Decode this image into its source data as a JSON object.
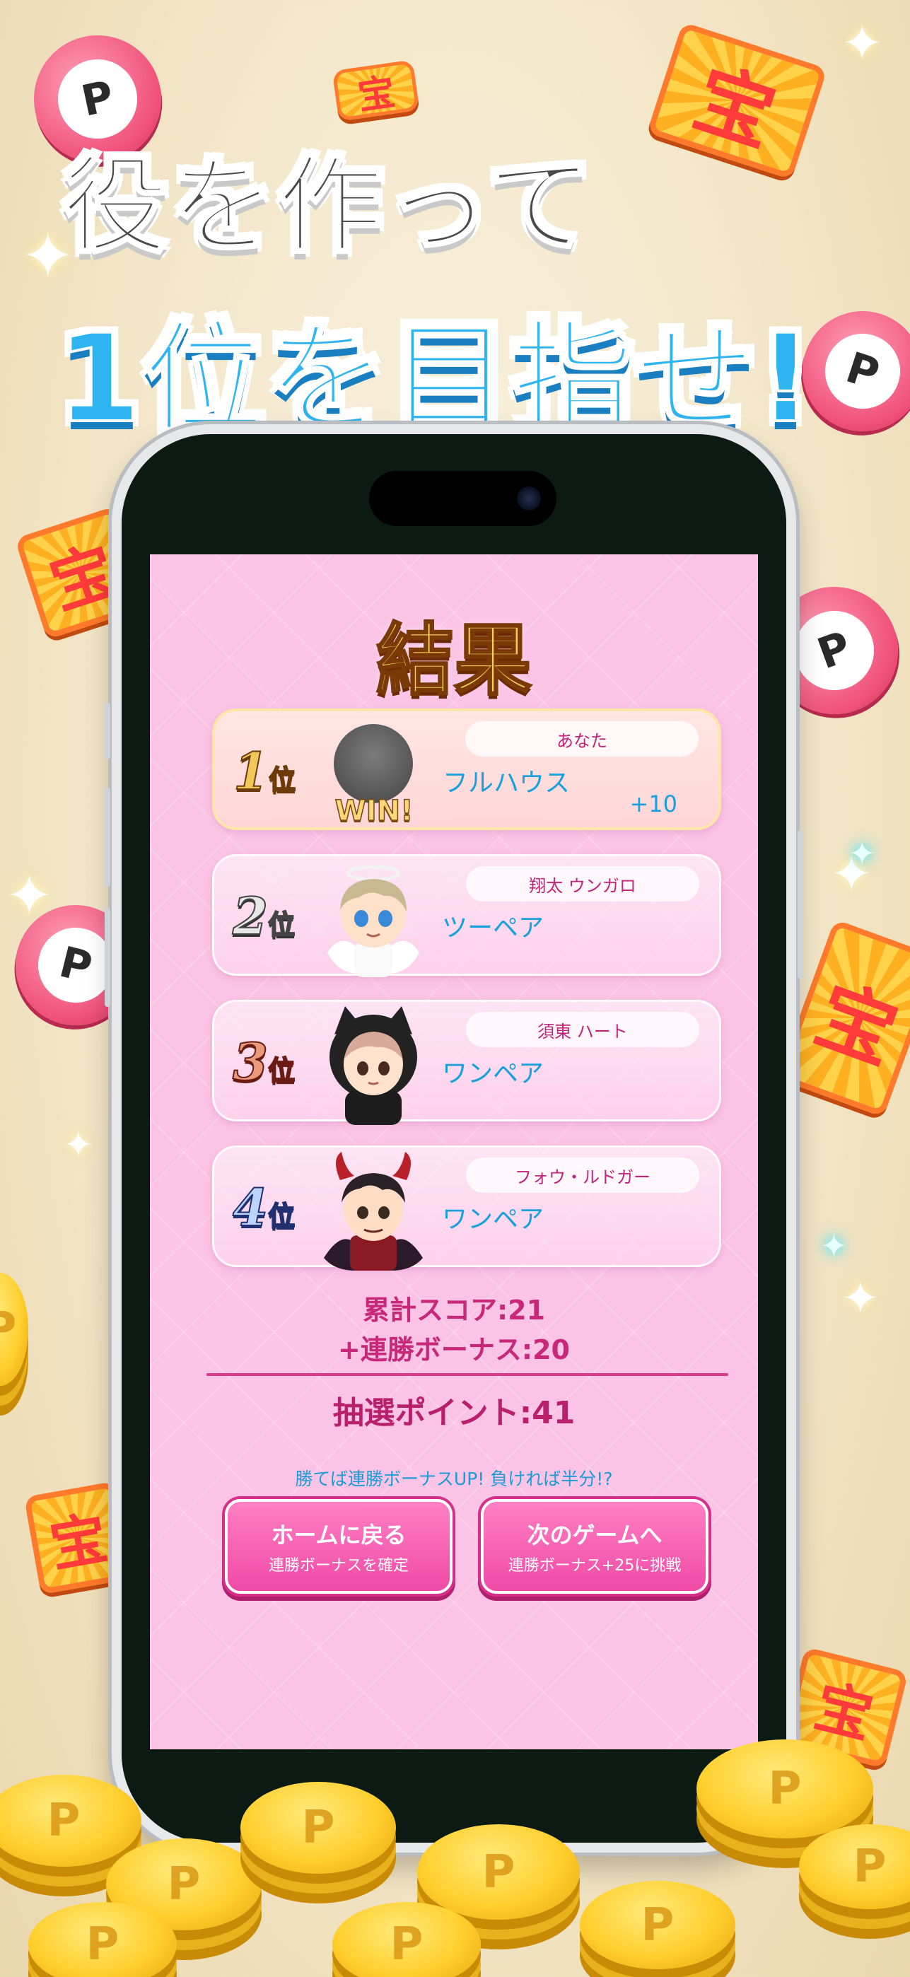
{
  "headline": {
    "line1": "役を作って",
    "line2": "1位を目指せ!"
  },
  "decorations": {
    "token_letter": "P",
    "takara_char": "宝"
  },
  "result": {
    "title": "結果",
    "rank_suffix": "位",
    "players": [
      {
        "rank": "1",
        "name": "あなた",
        "hand": "フルハウス",
        "bonus": "+10",
        "badge": "WIN!"
      },
      {
        "rank": "2",
        "name": "翔太 ウンガロ",
        "hand": "ツーペア"
      },
      {
        "rank": "3",
        "name": "須東 ハート",
        "hand": "ワンペア"
      },
      {
        "rank": "4",
        "name": "フォウ・ルドガー",
        "hand": "ワンペア"
      }
    ],
    "total_score": "累計スコア:21",
    "streak_bonus": "+連勝ボーナス:20",
    "lottery_points": "抽選ポイント:41",
    "hint": "勝てば連勝ボーナスUP! 負ければ半分!?",
    "buttons": {
      "home_main": "ホームに戻る",
      "home_sub": "連勝ボーナスを確定",
      "next_main": "次のゲームへ",
      "next_sub": "連勝ボーナス+25に挑戦"
    }
  },
  "colors": {
    "screen_bg": "#fbc4e6",
    "accent_pink": "#c8287a",
    "hand_blue": "#1aa0dc",
    "headline_blue": "#2fb4f2"
  }
}
